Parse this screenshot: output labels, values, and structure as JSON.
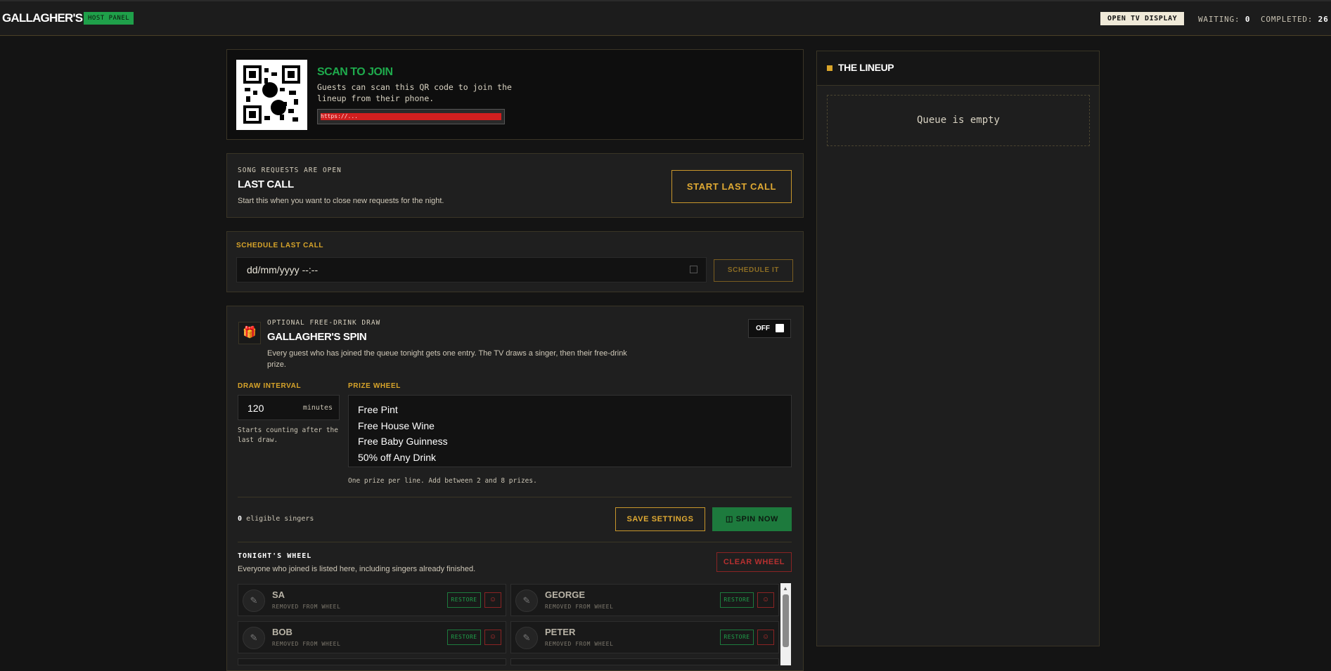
{
  "topbar": {
    "brand": "GALLAGHER'S",
    "badge": "HOST PANEL",
    "tv_button": "OPEN TV DISPLAY",
    "waiting_label": "WAITING:",
    "waiting_value": "0",
    "completed_label": "COMPLETED:",
    "completed_value": "26"
  },
  "join": {
    "title": "SCAN TO JOIN",
    "description": "Guests can scan this QR code to join the lineup from their phone.",
    "url_redacted": "https://..."
  },
  "last_call": {
    "status": "SONG REQUESTS ARE OPEN",
    "title": "LAST CALL",
    "description": "Start this when you want to close new requests for the night.",
    "button": "START LAST CALL"
  },
  "schedule": {
    "label": "SCHEDULE LAST CALL",
    "placeholder": "dd/mm/yyyy --:--",
    "button": "SCHEDULE IT"
  },
  "spin": {
    "kicker": "OPTIONAL FREE-DRINK DRAW",
    "title": "GALLAGHER'S SPIN",
    "description": "Every guest who has joined the queue tonight gets one entry. The TV draws a singer, then their free-drink prize.",
    "toggle_label": "OFF",
    "interval_label": "DRAW INTERVAL",
    "interval_value": "120",
    "interval_unit": "minutes",
    "interval_hint": "Starts counting after the last draw.",
    "prize_label": "PRIZE WHEEL",
    "prizes": [
      "Free Pint",
      "Free House Wine",
      "Free Baby Guinness",
      "50% off Any Drink"
    ],
    "prize_hint": "One prize per line. Add between 2 and 8 prizes.",
    "eligible_count": "0",
    "eligible_text": "eligible singers",
    "save_button": "SAVE SETTINGS",
    "spin_button": "SPIN NOW"
  },
  "wheel": {
    "title": "TONIGHT'S WHEEL",
    "description": "Everyone who joined is listed here, including singers already finished.",
    "clear_button": "CLEAR WHEEL",
    "restore_label": "RESTORE",
    "removed_label": "REMOVED FROM WHEEL",
    "singers": [
      {
        "name": "SA"
      },
      {
        "name": "GEORGE"
      },
      {
        "name": "BOB"
      },
      {
        "name": "PETER"
      }
    ]
  },
  "lineup": {
    "title": "THE LINEUP",
    "empty": "Queue is empty"
  },
  "colors": {
    "accent_gold": "#d9a52a",
    "accent_green": "#1fa04a",
    "danger_red": "#b73030"
  }
}
